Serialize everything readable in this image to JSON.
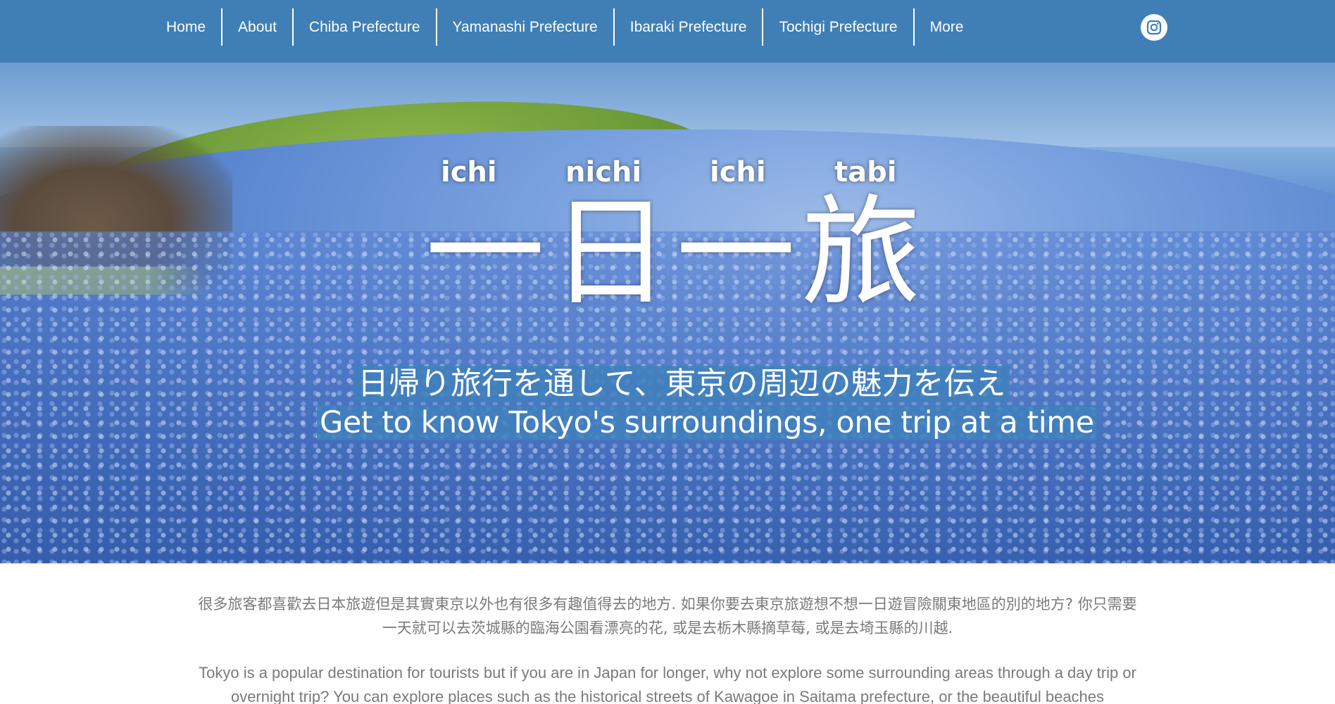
{
  "header": {
    "nav": [
      "Home",
      "About",
      "Chiba Prefecture",
      "Yamanashi Prefecture",
      "Ibaraki Prefecture",
      "Tochigi Prefecture",
      "More"
    ],
    "social_icon": "instagram-icon",
    "background_color": "#3f7fb5"
  },
  "hero": {
    "readings": [
      "ichi",
      "nichi",
      "ichi",
      "tabi"
    ],
    "title": "一日一旅",
    "tagline_jp": "日帰り旅行を通して、東京の周辺の魅力を伝え",
    "tagline_en": "Get to know Tokyo's surroundings, one trip at a time",
    "accent_color": "#4080bc"
  },
  "intro": {
    "chinese": "很多旅客都喜歡去日本旅遊但是其實東京以外也有很多有趣值得去的地方. 如果你要去東京旅遊想不想一日遊冒險關東地區的別的地方? 你只需要一天就可以去茨城縣的臨海公園看漂亮的花, 或是去栃木縣摘草莓, 或是去埼玉縣的川越.",
    "english": "Tokyo is a popular destination for tourists but if you are in Japan for longer, why not explore some surrounding areas through a day trip or overnight trip? You can explore places such as the historical streets of Kawagoe in Saitama prefecture, or the beautiful beaches"
  }
}
